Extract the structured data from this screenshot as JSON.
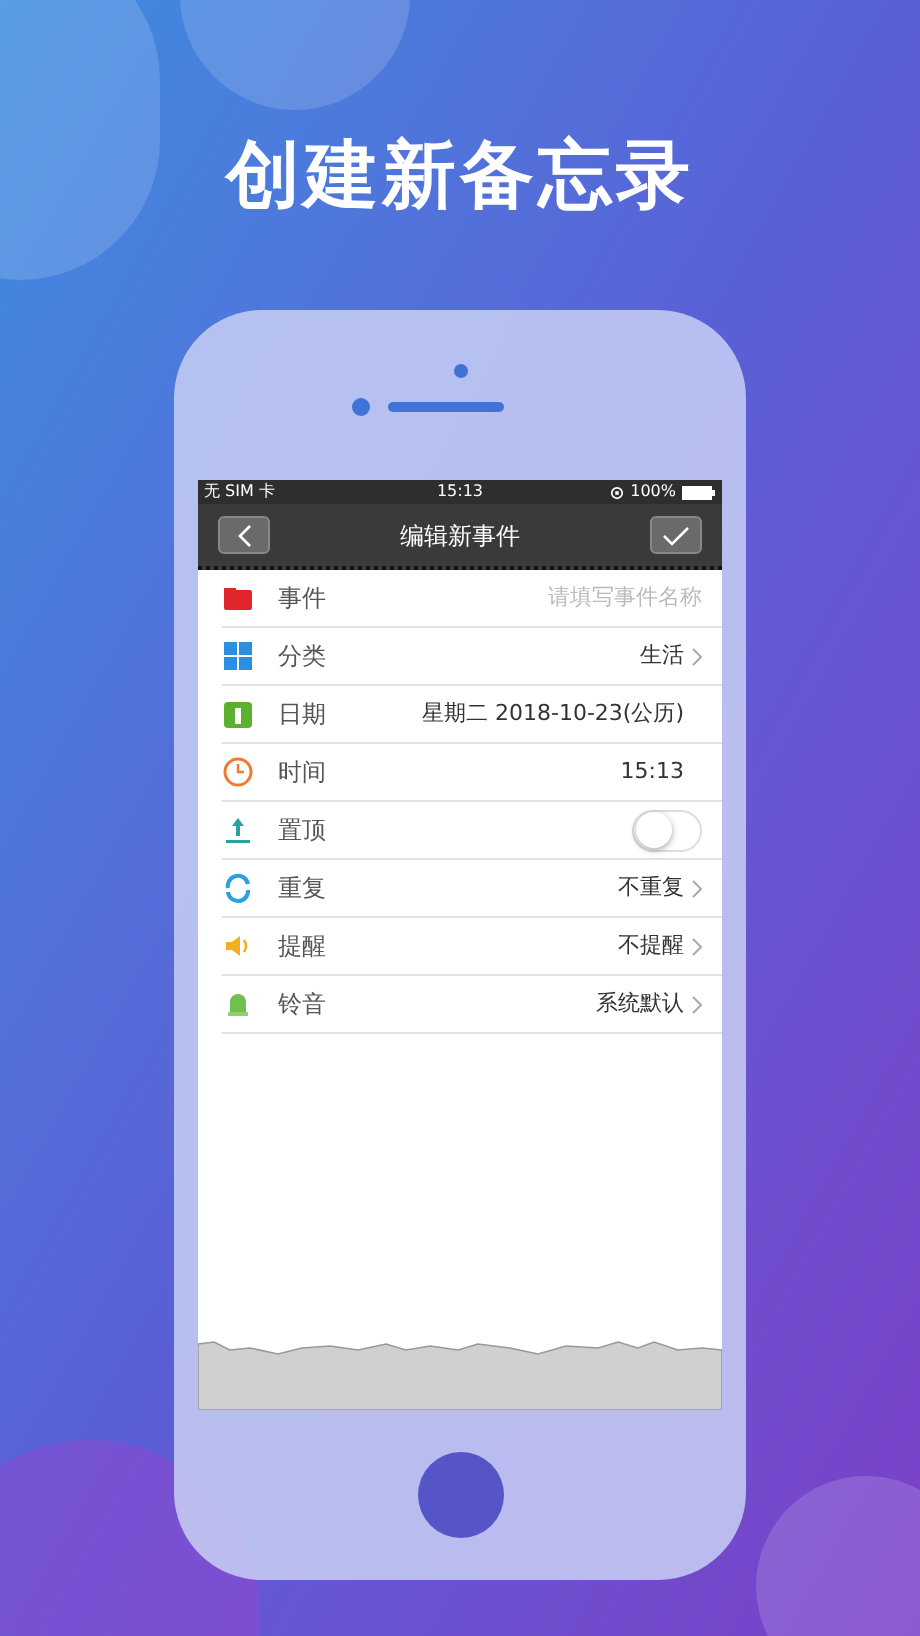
{
  "headline": "创建新备忘录",
  "status_bar": {
    "carrier": "无 SIM 卡",
    "time": "15:13",
    "battery": "100%"
  },
  "nav": {
    "title": "编辑新事件"
  },
  "rows": [
    {
      "kind": "input",
      "label": "事件",
      "placeholder": "请填写事件名称"
    },
    {
      "kind": "value",
      "label": "分类",
      "value": "生活",
      "chevron": true
    },
    {
      "kind": "value",
      "label": "日期",
      "value": "星期二 2018-10-23(公历)",
      "chevron": false
    },
    {
      "kind": "value",
      "label": "时间",
      "value": "15:13",
      "chevron": false
    },
    {
      "kind": "toggle",
      "label": "置顶",
      "on": false
    },
    {
      "kind": "value",
      "label": "重复",
      "value": "不重复",
      "chevron": true
    },
    {
      "kind": "value",
      "label": "提醒",
      "value": "不提醒",
      "chevron": true
    },
    {
      "kind": "value",
      "label": "铃音",
      "value": "系统默认",
      "chevron": true
    }
  ]
}
